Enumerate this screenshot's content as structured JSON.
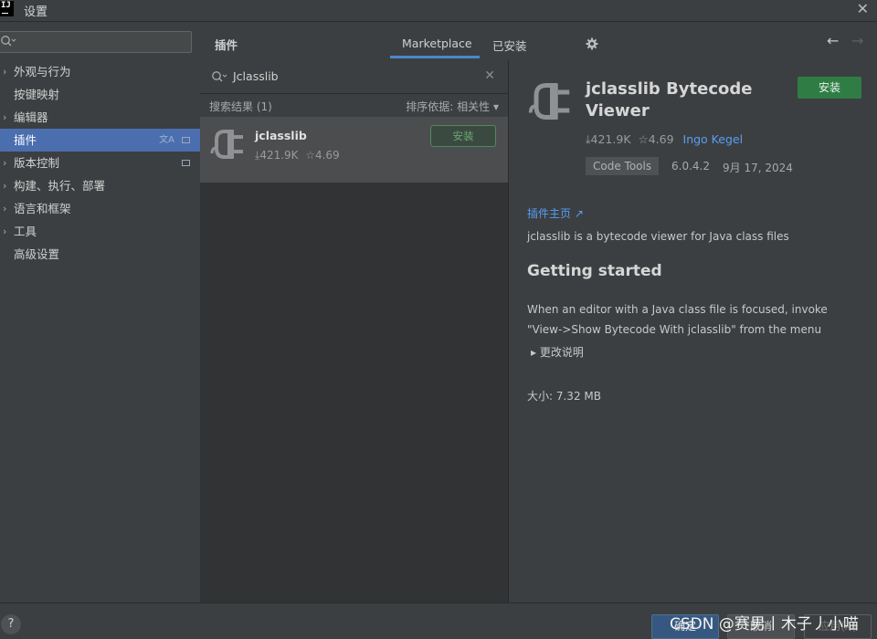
{
  "window": {
    "title": "设置",
    "app_icon_text": "IJ"
  },
  "sidebar": {
    "items": [
      {
        "label": "外观与行为",
        "expandable": true
      },
      {
        "label": "按键映射",
        "expandable": false
      },
      {
        "label": "编辑器",
        "expandable": true
      },
      {
        "label": "插件",
        "expandable": false,
        "selected": true
      },
      {
        "label": "版本控制",
        "expandable": true
      },
      {
        "label": "构建、执行、部署",
        "expandable": true
      },
      {
        "label": "语言和框架",
        "expandable": true
      },
      {
        "label": "工具",
        "expandable": true
      },
      {
        "label": "高级设置",
        "expandable": false
      }
    ]
  },
  "header": {
    "title": "插件",
    "tabs": [
      {
        "label": "Marketplace",
        "active": true
      },
      {
        "label": "已安装",
        "active": false
      }
    ]
  },
  "search": {
    "query": "Jclasslib"
  },
  "results": {
    "label": "搜索结果 (1)",
    "sort_label": "排序依据: 相关性",
    "items": [
      {
        "name": "jclasslib",
        "downloads": "421.9K",
        "rating": "4.69",
        "install_label": "安装"
      }
    ]
  },
  "detail": {
    "title_line1": "jclasslib Bytecode",
    "title_line2": "Viewer",
    "install_label": "安装",
    "downloads": "421.9K",
    "rating": "4.69",
    "author": "Ingo Kegel",
    "tag": "Code Tools",
    "version": "6.0.4.2",
    "date": "9月 17, 2024",
    "homepage_link": "插件主页",
    "description": "jclasslib is a bytecode viewer for Java class files",
    "heading": "Getting started",
    "para_line1": "When an editor with a Java class file is focused, invoke",
    "para_line2": "\"View->Show Bytecode With jclasslib\" from the menu",
    "changes_label": "更改说明",
    "size": "大小: 7.32 MB"
  },
  "footer": {
    "help": "?",
    "ok": "确定",
    "cancel": "取消",
    "apply": "应用(A)",
    "watermark": "CSDN @赛男丨木子丿小喵"
  },
  "colors": {
    "accent": "#4b6eaf",
    "install_green": "#2f7d45",
    "link": "#589df6"
  }
}
